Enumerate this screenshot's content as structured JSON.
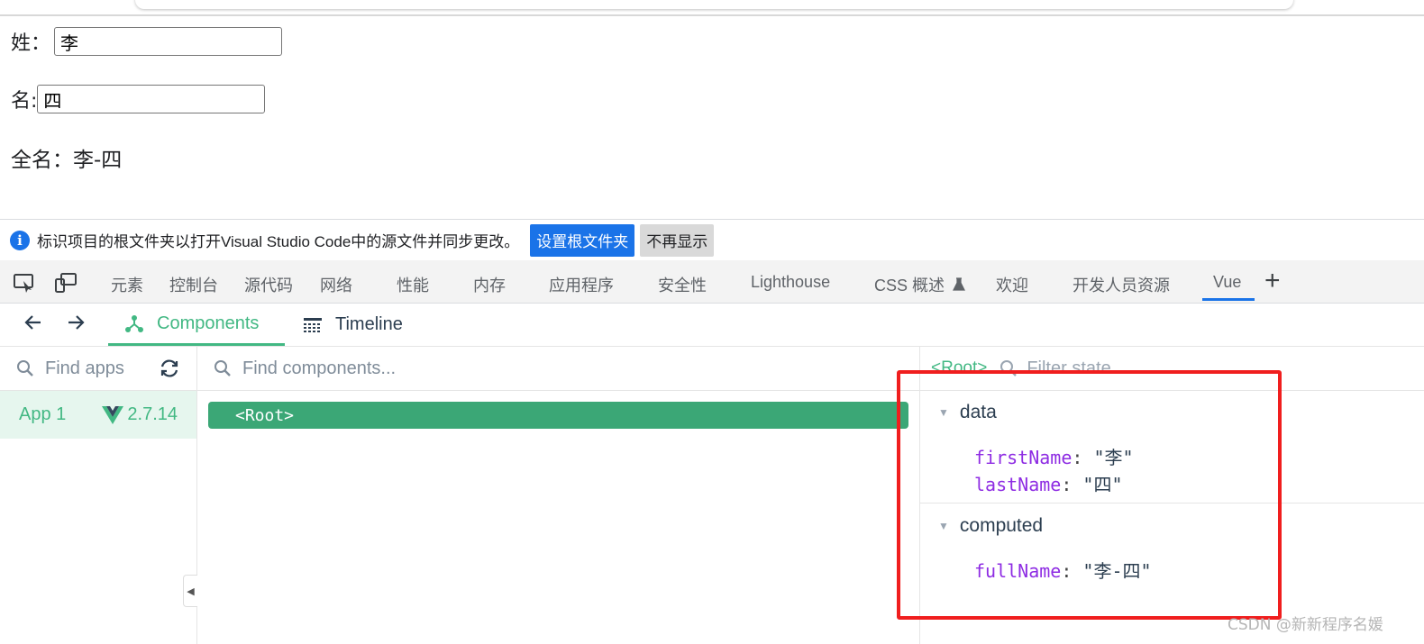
{
  "page": {
    "surname_label": "姓：",
    "surname_value": "李",
    "givenname_label": "名:",
    "givenname_value": "四",
    "fullname_text": "全名：李-四"
  },
  "infobar": {
    "message": "标识项目的根文件夹以打开Visual Studio Code中的源文件并同步更改。",
    "primary_button": "设置根文件夹",
    "secondary_button": "不再显示",
    "icon": "info-icon",
    "accent": "#1a73e8"
  },
  "devtools_tabs": {
    "items": [
      "元素",
      "控制台",
      "源代码",
      "网络",
      "性能",
      "内存",
      "应用程序",
      "安全性",
      "Lighthouse",
      "CSS 概述",
      "欢迎",
      "开发人员资源",
      "Vue"
    ],
    "active": "Vue"
  },
  "vue_toolbar": {
    "components_label": "Components",
    "timeline_label": "Timeline"
  },
  "apps_panel": {
    "search_placeholder": "Find apps",
    "app_name": "App 1",
    "vue_version": "2.7.14"
  },
  "components_panel": {
    "search_placeholder": "Find components...",
    "root_node": "<Root>"
  },
  "state_panel": {
    "root_name": "<Root>",
    "filter_placeholder": "Filter state...",
    "data_title": "data",
    "data_props": [
      {
        "key": "firstName",
        "value": "\"李\""
      },
      {
        "key": "lastName",
        "value": "\"四\""
      }
    ],
    "computed_title": "computed",
    "computed_props": [
      {
        "key": "fullName",
        "value": "\"李-四\""
      }
    ]
  },
  "colors": {
    "vue_green": "#42b883",
    "root_node_green": "#3ba776",
    "highlight_red": "#f01e1e"
  },
  "watermark": "CSDN @新新程序名媛"
}
